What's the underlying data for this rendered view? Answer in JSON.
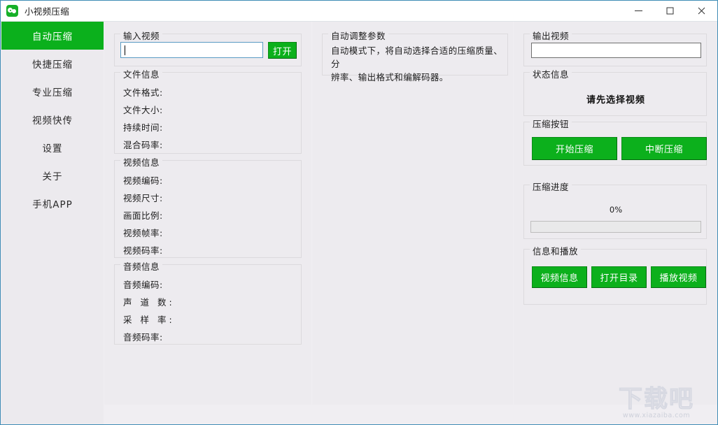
{
  "window": {
    "title": "小视频压缩",
    "icon": "video-compress-app-icon",
    "controls": {
      "minimize": "minimize-icon",
      "maximize": "maximize-icon",
      "close": "close-icon"
    },
    "border_color": "#3f8cb5"
  },
  "theme": {
    "accent": "#0bb01c",
    "button_green": "#0cb01c",
    "panel_bg": "#edebef",
    "sidebar_bg": "#eceaee",
    "group_border": "#dcdadd",
    "input_focus_border": "#5a9bc4"
  },
  "sidebar": {
    "items": [
      {
        "label": "自动压缩",
        "active": true
      },
      {
        "label": "快捷压缩",
        "active": false
      },
      {
        "label": "专业压缩",
        "active": false
      },
      {
        "label": "视频快传",
        "active": false
      },
      {
        "label": "设置",
        "active": false
      },
      {
        "label": "关于",
        "active": false
      },
      {
        "label": "手机APP",
        "active": false
      }
    ]
  },
  "left_column": {
    "input_video": {
      "legend": "输入视频",
      "path_value": "",
      "open_button": "打开"
    },
    "file_info": {
      "legend": "文件信息",
      "rows": [
        {
          "label": "文件格式:",
          "value": ""
        },
        {
          "label": "文件大小:",
          "value": ""
        },
        {
          "label": "持续时间:",
          "value": ""
        },
        {
          "label": "混合码率:",
          "value": ""
        }
      ]
    },
    "video_info": {
      "legend": "视频信息",
      "rows": [
        {
          "label": "视频编码:",
          "value": ""
        },
        {
          "label": "视频尺寸:",
          "value": ""
        },
        {
          "label": "画面比例:",
          "value": ""
        },
        {
          "label": "视频帧率:",
          "value": ""
        },
        {
          "label": "视频码率:",
          "value": ""
        }
      ]
    },
    "audio_info": {
      "legend": "音频信息",
      "rows": [
        {
          "label": "音频编码:",
          "value": ""
        },
        {
          "label": "声 道 数:",
          "value": ""
        },
        {
          "label": "采 样 率:",
          "value": ""
        },
        {
          "label": "音频码率:",
          "value": ""
        }
      ]
    }
  },
  "middle_column": {
    "auto_params": {
      "legend": "自动调整参数",
      "description_line1": "自动模式下，将自动选择合适的压缩质量、分",
      "description_line2": "辨率、输出格式和编解码器。"
    }
  },
  "right_column": {
    "output_video": {
      "legend": "输出视频",
      "path_value": ""
    },
    "status": {
      "legend": "状态信息",
      "message": "请先选择视频"
    },
    "compress_buttons": {
      "legend": "压缩按钮",
      "start": "开始压缩",
      "abort": "中断压缩"
    },
    "progress": {
      "legend": "压缩进度",
      "percent_label": "0%",
      "percent_value": 0
    },
    "info_playback": {
      "legend": "信息和播放",
      "buttons": [
        "视频信息",
        "打开目录",
        "播放视频"
      ]
    }
  },
  "watermark": {
    "brand": "下载吧",
    "url": "www.xiazaiba.com"
  }
}
